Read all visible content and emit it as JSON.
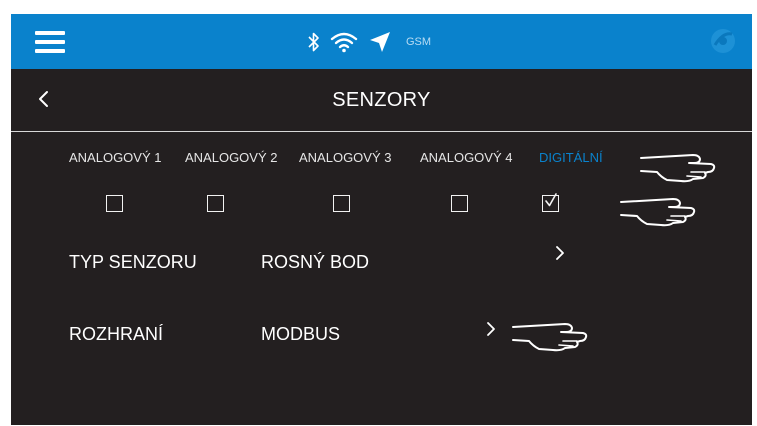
{
  "status_bar": {
    "icons": [
      "bluetooth-icon",
      "wifi-icon",
      "location-arrow-icon"
    ],
    "network_label": "GSM"
  },
  "header": {
    "title": "SENZORY"
  },
  "tabs": [
    {
      "label": "ANALOGOVÝ 1",
      "active": false
    },
    {
      "label": "ANALOGOVÝ 2",
      "active": false
    },
    {
      "label": "ANALOGOVÝ 3",
      "active": false
    },
    {
      "label": "ANALOGOVÝ 4",
      "active": false
    },
    {
      "label": "DIGITÁLNÍ",
      "active": true
    }
  ],
  "checkboxes": [
    {
      "for": "ANALOGOVÝ 1",
      "checked": false
    },
    {
      "for": "ANALOGOVÝ 2",
      "checked": false
    },
    {
      "for": "ANALOGOVÝ 3",
      "checked": false
    },
    {
      "for": "ANALOGOVÝ 4",
      "checked": false
    },
    {
      "for": "DIGITÁLNÍ",
      "checked": true
    }
  ],
  "settings": [
    {
      "label": "TYP SENZORU",
      "value": "ROSNÝ BOD"
    },
    {
      "label": "ROZHRANÍ",
      "value": "MODBUS"
    }
  ],
  "colors": {
    "accent": "#0a82cc",
    "background": "#231f20",
    "text": "#ffffff"
  }
}
